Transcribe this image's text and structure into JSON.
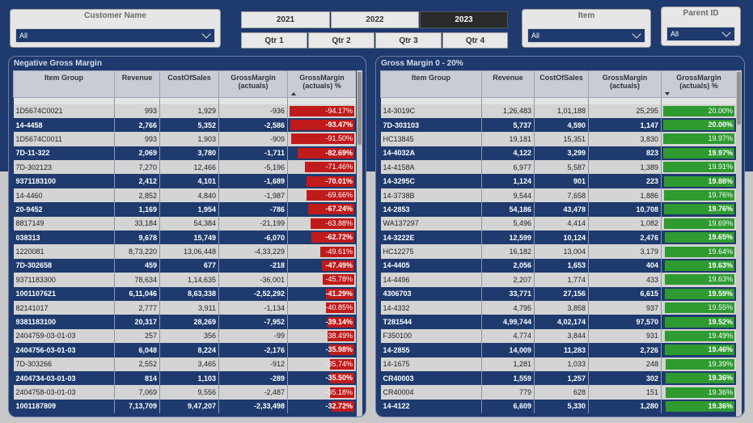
{
  "slicers": {
    "customer_name": {
      "title": "Customer Name",
      "value": "All"
    },
    "item": {
      "title": "Item",
      "value": "All"
    },
    "parent_id": {
      "title": "Parent ID",
      "value": "All"
    }
  },
  "years": [
    {
      "label": "2021",
      "active": false
    },
    {
      "label": "2022",
      "active": false
    },
    {
      "label": "2023",
      "active": true
    }
  ],
  "quarters": [
    {
      "label": "Qtr 1"
    },
    {
      "label": "Qtr 2"
    },
    {
      "label": "Qtr 3"
    },
    {
      "label": "Qtr 4"
    }
  ],
  "colors": {
    "navy": "#1e3a6e",
    "negative_bar": "#c01b1b",
    "positive_bar": "#2e9a30"
  },
  "left_table": {
    "title": "Negative Gross Margin",
    "columns": [
      "Item Group",
      "Revenue",
      "CostOfSales",
      "GrossMargin (actuals)",
      "GrossMargin (actuals) %"
    ],
    "sort": "ascending",
    "rows": [
      [
        "1D5674C0021",
        "993",
        "1,929",
        "-936",
        "-94.17%",
        94.17
      ],
      [
        "14-4458",
        "2,766",
        "5,352",
        "-2,586",
        "-93.47%",
        93.47
      ],
      [
        "1D5674C0011",
        "993",
        "1,903",
        "-909",
        "-91.50%",
        91.5
      ],
      [
        "7D-11-322",
        "2,069",
        "3,780",
        "-1,711",
        "-82.69%",
        82.69
      ],
      [
        "7D-302123",
        "7,270",
        "12,466",
        "-5,196",
        "-71.46%",
        71.46
      ],
      [
        "9371183100",
        "2,412",
        "4,101",
        "-1,689",
        "-70.01%",
        70.01
      ],
      [
        "14-4460",
        "2,852",
        "4,840",
        "-1,987",
        "-69.66%",
        69.66
      ],
      [
        "20-9452",
        "1,169",
        "1,954",
        "-786",
        "-67.24%",
        67.24
      ],
      [
        "8817149",
        "33,184",
        "54,384",
        "-21,199",
        "-63.88%",
        63.88
      ],
      [
        "038313",
        "9,678",
        "15,749",
        "-6,070",
        "-62.72%",
        62.72
      ],
      [
        "1220081",
        "8,73,220",
        "13,06,448",
        "-4,33,229",
        "-49.61%",
        49.61
      ],
      [
        "7D-302658",
        "459",
        "677",
        "-218",
        "-47.49%",
        47.49
      ],
      [
        "9371183300",
        "78,634",
        "1,14,635",
        "-36,001",
        "-45.78%",
        45.78
      ],
      [
        "1001107621",
        "6,11,046",
        "8,63,338",
        "-2,52,292",
        "-41.29%",
        41.29
      ],
      [
        "82141017",
        "2,777",
        "3,911",
        "-1,134",
        "-40.85%",
        40.85
      ],
      [
        "9381183100",
        "20,317",
        "28,269",
        "-7,952",
        "-39.14%",
        39.14
      ],
      [
        "2404759-03-01-03",
        "257",
        "356",
        "-99",
        "-38.49%",
        38.49
      ],
      [
        "2404756-03-01-03",
        "6,048",
        "8,224",
        "-2,176",
        "-35.98%",
        35.98
      ],
      [
        "7D-303266",
        "2,552",
        "3,465",
        "-912",
        "-35.74%",
        35.74
      ],
      [
        "2404734-03-01-03",
        "814",
        "1,103",
        "-289",
        "-35.50%",
        35.5
      ],
      [
        "2404758-03-01-03",
        "7,069",
        "9,556",
        "-2,487",
        "-35.18%",
        35.18
      ],
      [
        "1001187809",
        "7,13,709",
        "9,47,207",
        "-2,33,498",
        "-32.72%",
        32.72
      ]
    ]
  },
  "right_table": {
    "title": "Gross Margin 0 - 20%",
    "columns": [
      "Item Group",
      "Revenue",
      "CostOfSales",
      "GrossMargin (actuals)",
      "GrossMargin (actuals) %"
    ],
    "sort": "descending",
    "rows": [
      [
        "14-3019C",
        "1,26,483",
        "1,01,188",
        "25,295",
        "20.00%",
        20.0
      ],
      [
        "7D-303103",
        "5,737",
        "4,590",
        "1,147",
        "20.00%",
        20.0
      ],
      [
        "HC13845",
        "19,181",
        "15,351",
        "3,830",
        "19.97%",
        19.97
      ],
      [
        "14-4032A",
        "4,122",
        "3,299",
        "823",
        "19.97%",
        19.97
      ],
      [
        "14-4158A",
        "6,977",
        "5,587",
        "1,389",
        "19.91%",
        19.91
      ],
      [
        "14-3295C",
        "1,124",
        "901",
        "223",
        "19.88%",
        19.88
      ],
      [
        "14-3738B",
        "9,544",
        "7,658",
        "1,886",
        "19.76%",
        19.76
      ],
      [
        "14-2853",
        "54,186",
        "43,478",
        "10,708",
        "19.76%",
        19.76
      ],
      [
        "WA137297",
        "5,496",
        "4,414",
        "1,082",
        "19.69%",
        19.69
      ],
      [
        "14-3222E",
        "12,599",
        "10,124",
        "2,476",
        "19.65%",
        19.65
      ],
      [
        "HC12275",
        "16,182",
        "13,004",
        "3,179",
        "19.64%",
        19.64
      ],
      [
        "14-4405",
        "2,056",
        "1,653",
        "404",
        "19.63%",
        19.63
      ],
      [
        "14-4496",
        "2,207",
        "1,774",
        "433",
        "19.63%",
        19.63
      ],
      [
        "4306703",
        "33,771",
        "27,156",
        "6,615",
        "19.59%",
        19.59
      ],
      [
        "14-4332",
        "4,795",
        "3,858",
        "937",
        "19.55%",
        19.55
      ],
      [
        "T281544",
        "4,99,744",
        "4,02,174",
        "97,570",
        "19.52%",
        19.52
      ],
      [
        "F350100",
        "4,774",
        "3,844",
        "931",
        "19.49%",
        19.49
      ],
      [
        "14-2855",
        "14,009",
        "11,283",
        "2,726",
        "19.46%",
        19.46
      ],
      [
        "14-1675",
        "1,281",
        "1,033",
        "248",
        "19.39%",
        19.39
      ],
      [
        "CR40003",
        "1,559",
        "1,257",
        "302",
        "19.36%",
        19.36
      ],
      [
        "CR40004",
        "779",
        "628",
        "151",
        "19.36%",
        19.36
      ],
      [
        "14-4122",
        "6,609",
        "5,330",
        "1,280",
        "19.36%",
        19.36
      ]
    ]
  }
}
